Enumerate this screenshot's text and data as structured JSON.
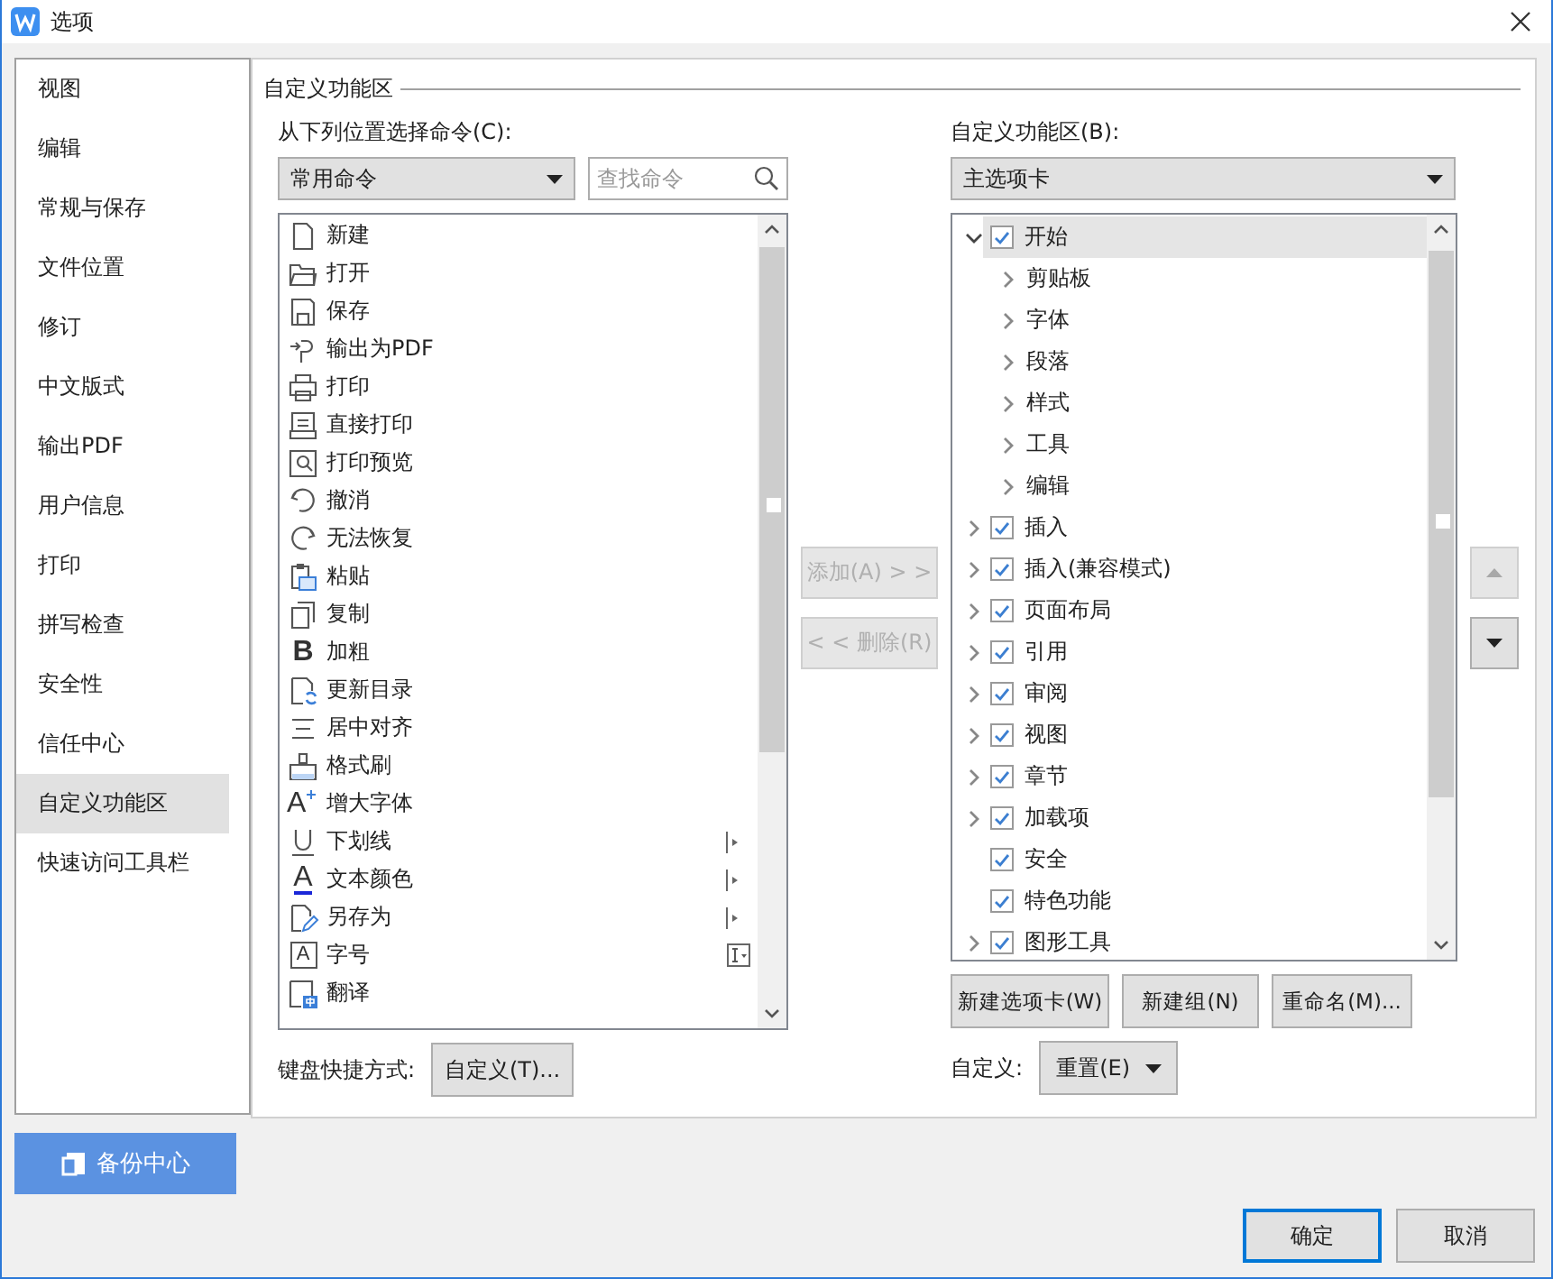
{
  "window": {
    "title": "选项"
  },
  "sidebar": {
    "items": [
      {
        "label": "视图",
        "selected": false
      },
      {
        "label": "编辑",
        "selected": false
      },
      {
        "label": "常规与保存",
        "selected": false
      },
      {
        "label": "文件位置",
        "selected": false
      },
      {
        "label": "修订",
        "selected": false
      },
      {
        "label": "中文版式",
        "selected": false
      },
      {
        "label": "输出PDF",
        "selected": false
      },
      {
        "label": "用户信息",
        "selected": false
      },
      {
        "label": "打印",
        "selected": false
      },
      {
        "label": "拼写检查",
        "selected": false
      },
      {
        "label": "安全性",
        "selected": false
      },
      {
        "label": "信任中心",
        "selected": false
      },
      {
        "label": "自定义功能区",
        "selected": true
      },
      {
        "label": "快速访问工具栏",
        "selected": false
      }
    ]
  },
  "backup_button": "备份中心",
  "section_title": "自定义功能区",
  "commands": {
    "label": "从下列位置选择命令(C):",
    "source": {
      "value": "常用命令"
    },
    "search": {
      "placeholder": "查找命令"
    },
    "items": [
      {
        "label": "新建",
        "kind": "plain"
      },
      {
        "label": "打开",
        "kind": "plain"
      },
      {
        "label": "保存",
        "kind": "plain"
      },
      {
        "label": "输出为PDF",
        "kind": "plain"
      },
      {
        "label": "打印",
        "kind": "plain"
      },
      {
        "label": "直接打印",
        "kind": "plain"
      },
      {
        "label": "打印预览",
        "kind": "plain"
      },
      {
        "label": "撤消",
        "kind": "plain"
      },
      {
        "label": "无法恢复",
        "kind": "plain"
      },
      {
        "label": "粘贴",
        "kind": "plain"
      },
      {
        "label": "复制",
        "kind": "plain"
      },
      {
        "label": "加粗",
        "kind": "plain",
        "glyph": "B"
      },
      {
        "label": "更新目录",
        "kind": "plain"
      },
      {
        "label": "居中对齐",
        "kind": "plain"
      },
      {
        "label": "格式刷",
        "kind": "plain"
      },
      {
        "label": "增大字体",
        "kind": "plain",
        "glyph": "A"
      },
      {
        "label": "下划线",
        "kind": "submenu"
      },
      {
        "label": "文本颜色",
        "kind": "submenu",
        "glyph": "A"
      },
      {
        "label": "另存为",
        "kind": "submenu"
      },
      {
        "label": "字号",
        "kind": "combo",
        "glyph": "A"
      },
      {
        "label": "翻译",
        "kind": "plain"
      }
    ],
    "shortcut_label": "键盘快捷方式:",
    "shortcut_button": "自定义(T)..."
  },
  "middle_buttons": [
    {
      "label": "添加(A) > >",
      "disabled": true
    },
    {
      "label": "< < 删除(R)",
      "disabled": true
    }
  ],
  "ribbon": {
    "label": "自定义功能区(B):",
    "source": {
      "value": "主选项卡"
    },
    "tree": [
      {
        "label": "开始",
        "kind": "tab",
        "checked": true,
        "expandable": true,
        "expanded": true,
        "selected": true,
        "children": [
          {
            "label": "剪贴板",
            "kind": "group",
            "expandable": true
          },
          {
            "label": "字体",
            "kind": "group",
            "expandable": true
          },
          {
            "label": "段落",
            "kind": "group",
            "expandable": true
          },
          {
            "label": "样式",
            "kind": "group",
            "expandable": true
          },
          {
            "label": "工具",
            "kind": "group",
            "expandable": true
          },
          {
            "label": "编辑",
            "kind": "group",
            "expandable": true
          }
        ]
      },
      {
        "label": "插入",
        "kind": "tab",
        "checked": true,
        "expandable": true,
        "expanded": false,
        "selected": false
      },
      {
        "label": "插入(兼容模式)",
        "kind": "tab",
        "checked": true,
        "expandable": true,
        "expanded": false,
        "selected": false
      },
      {
        "label": "页面布局",
        "kind": "tab",
        "checked": true,
        "expandable": true,
        "expanded": false,
        "selected": false
      },
      {
        "label": "引用",
        "kind": "tab",
        "checked": true,
        "expandable": true,
        "expanded": false,
        "selected": false
      },
      {
        "label": "审阅",
        "kind": "tab",
        "checked": true,
        "expandable": true,
        "expanded": false,
        "selected": false
      },
      {
        "label": "视图",
        "kind": "tab",
        "checked": true,
        "expandable": true,
        "expanded": false,
        "selected": false
      },
      {
        "label": "章节",
        "kind": "tab",
        "checked": true,
        "expandable": true,
        "expanded": false,
        "selected": false
      },
      {
        "label": "加载项",
        "kind": "tab",
        "checked": true,
        "expandable": true,
        "expanded": false,
        "selected": false
      },
      {
        "label": "安全",
        "kind": "tab",
        "checked": true,
        "expandable": false,
        "expanded": false,
        "selected": false
      },
      {
        "label": "特色功能",
        "kind": "tab",
        "checked": true,
        "expandable": false,
        "expanded": false,
        "selected": false
      },
      {
        "label": "图形工具",
        "kind": "tab",
        "checked": true,
        "expandable": true,
        "expanded": false,
        "selected": false
      }
    ],
    "buttons": [
      "新建选项卡(W)",
      "新建组(N)",
      "重命名(M)..."
    ],
    "customize_label": "自定义:",
    "reset_button": "重置(E)"
  },
  "order_buttons": [
    {
      "kind": "up",
      "disabled": true
    },
    {
      "kind": "down",
      "disabled": false
    }
  ],
  "footer": {
    "buttons": [
      {
        "label": "确定",
        "default": true
      },
      {
        "label": "取消",
        "default": false
      }
    ]
  }
}
